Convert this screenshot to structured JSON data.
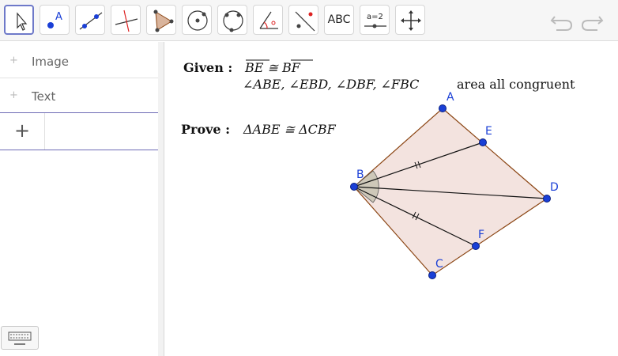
{
  "toolbar": {
    "tools": [
      {
        "name": "move-tool",
        "label": ""
      },
      {
        "name": "point-tool",
        "label": "A"
      },
      {
        "name": "line-tool",
        "label": ""
      },
      {
        "name": "perpendicular-line-tool",
        "label": ""
      },
      {
        "name": "polygon-tool",
        "label": ""
      },
      {
        "name": "circle-center-point-tool",
        "label": ""
      },
      {
        "name": "circle-three-points-tool",
        "label": ""
      },
      {
        "name": "angle-tool",
        "label": ""
      },
      {
        "name": "reflect-about-line-tool",
        "label": ""
      },
      {
        "name": "text-tool",
        "label": "ABC"
      },
      {
        "name": "slider-tool",
        "label": "a=2"
      },
      {
        "name": "move-graphics-view-tool",
        "label": ""
      }
    ]
  },
  "algebra": {
    "items": [
      {
        "label": "Image"
      },
      {
        "label": "Text"
      }
    ],
    "input_plus": "+"
  },
  "graphics": {
    "given_label": "Given :",
    "given_line1": "BE ≅ BF",
    "given_line2_math": "∠ABE, ∠EBD, ∠DBF, ∠FBC",
    "given_line2_text": "area all congruent",
    "prove_label": "Prove :",
    "prove_text": "ΔABE ≅ ΔCBF",
    "points": {
      "A": "A",
      "B": "B",
      "C": "C",
      "D": "D",
      "E": "E",
      "F": "F"
    },
    "colors": {
      "point": "#1a3fd6",
      "polygon_fill": "#f3e3df",
      "polygon_edge": "#8b4513",
      "angle_fill": "#b5b5a0"
    }
  }
}
